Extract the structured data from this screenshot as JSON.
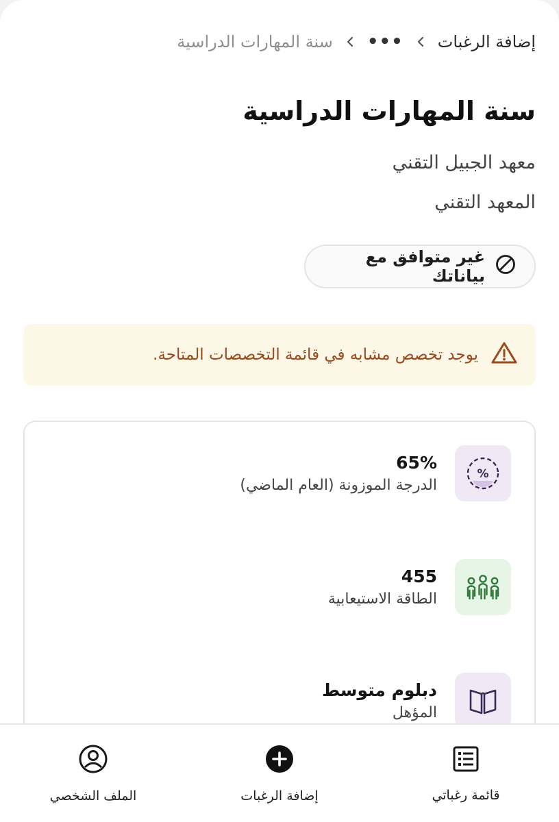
{
  "breadcrumb": {
    "first": "إضافة الرغبات",
    "ellipsis": "•••",
    "current": "سنة المهارات الدراسية"
  },
  "program": {
    "title": "سنة المهارات الدراسية",
    "institute": "معهد الجبيل التقني",
    "type": "المعهد التقني"
  },
  "compatibility": {
    "label": "غير متوافق مع بياناتك",
    "icon": "prohibited-icon"
  },
  "warning": {
    "text": "يوجد تخصص مشابه في قائمة التخصصات المتاحة.",
    "icon": "warning-triangle-icon",
    "color": "#9a4b1d",
    "background": "#fdf7e7"
  },
  "stats": [
    {
      "value": "65%",
      "label": "الدرجة الموزونة (العام الماضي)",
      "icon": "percent-badge-icon",
      "bg": "#f1e8f6"
    },
    {
      "value": "455",
      "label": "الطاقة الاستيعابية",
      "icon": "people-group-icon",
      "bg": "#e6f5e6"
    },
    {
      "value": "دبلوم متوسط",
      "label": "المؤهل",
      "icon": "open-book-icon",
      "bg": "#f1e8f6"
    }
  ],
  "bottom_nav": {
    "wishlist": "قائمة رغباتي",
    "add": "إضافة الرغبات",
    "profile": "الملف الشخصي"
  }
}
